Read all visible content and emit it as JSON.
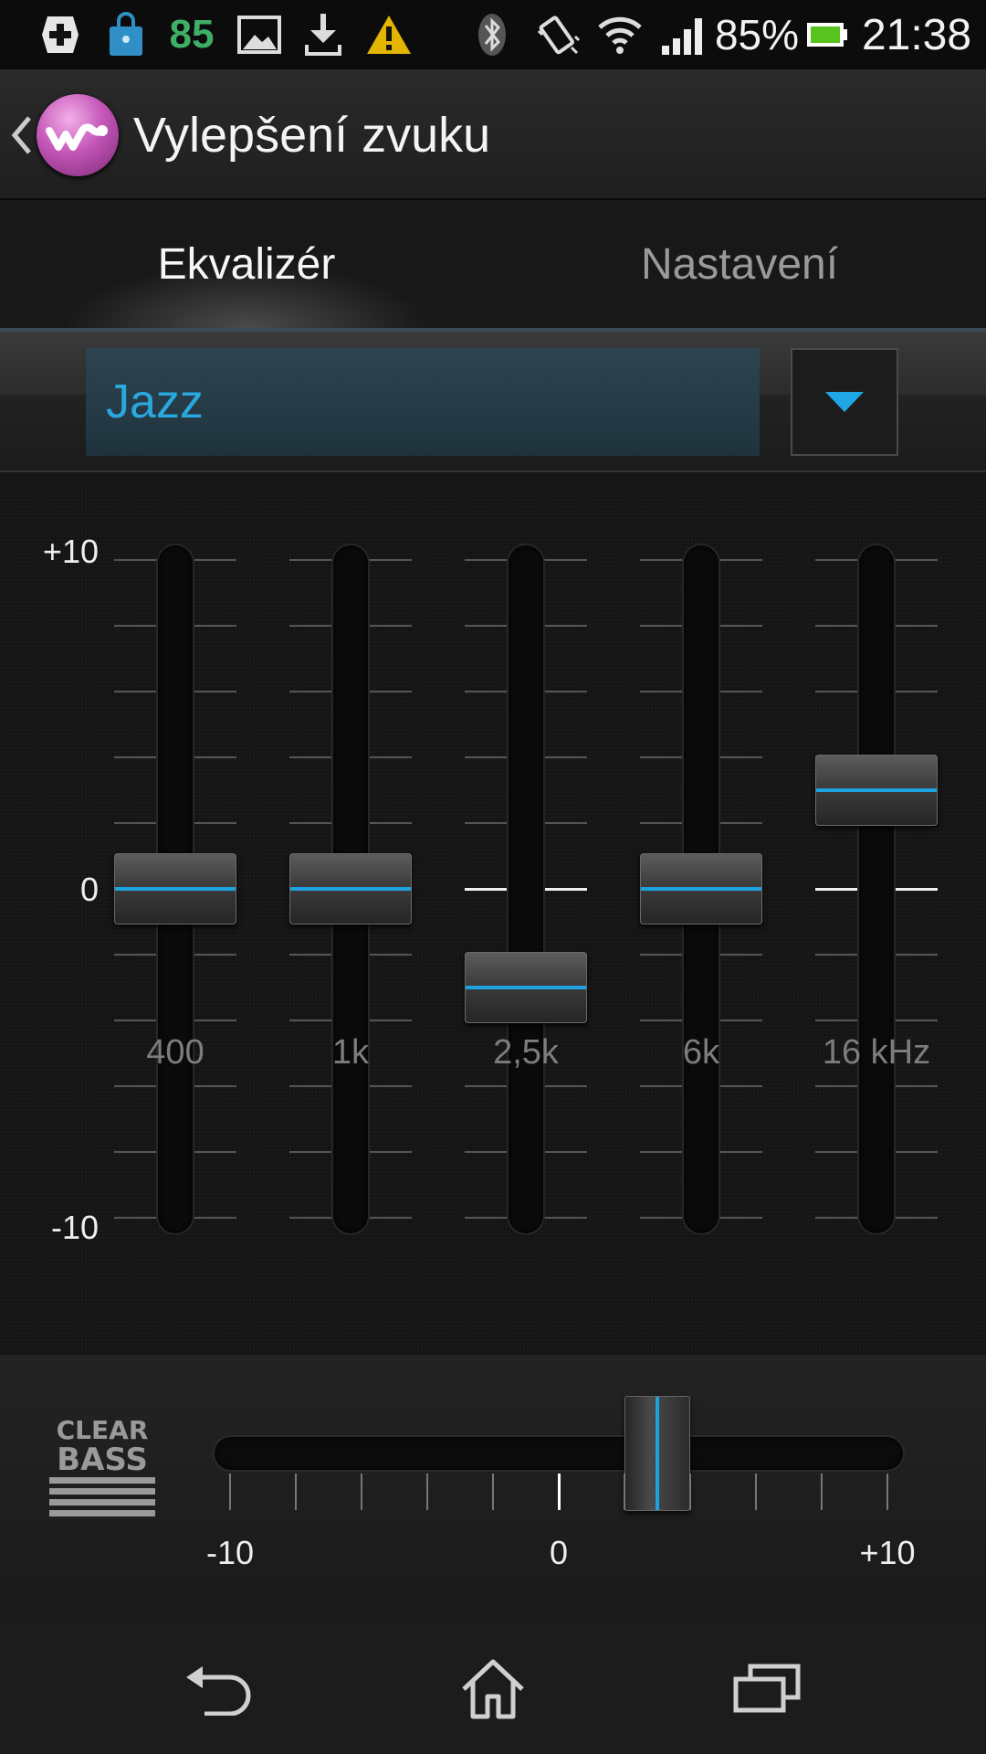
{
  "status_bar": {
    "notification_count": "85",
    "battery_percent": "85%",
    "time": "21:38",
    "icons": [
      "add-box-icon",
      "store-bag-icon",
      "gallery-icon",
      "download-icon",
      "warning-icon",
      "bluetooth-icon",
      "vibrate-icon",
      "wifi-icon",
      "signal-icon",
      "battery-icon"
    ]
  },
  "action_bar": {
    "title": "Vylepšení zvuku",
    "app_icon": "walkman-icon"
  },
  "tabs": [
    {
      "label": "Ekvalizér",
      "active": true
    },
    {
      "label": "Nastavení",
      "active": false
    }
  ],
  "preset": {
    "selected": "Jazz",
    "accent_color": "#29a8df"
  },
  "equalizer": {
    "scale_labels": {
      "max": "+10",
      "zero": "0",
      "min": "-10"
    },
    "bands": [
      {
        "label": "400",
        "value": 0
      },
      {
        "label": "1k",
        "value": 0
      },
      {
        "label": "2,5k",
        "value": -3
      },
      {
        "label": "6k",
        "value": 0
      },
      {
        "label": "16 kHz",
        "value": 3
      }
    ],
    "min": -10,
    "max": 10
  },
  "clear_bass": {
    "logo_text_top": "CLEAR",
    "logo_text_bottom": "BASS",
    "value": 3,
    "min": -10,
    "max": 10,
    "labels": {
      "min": "-10",
      "zero": "0",
      "max": "+10"
    }
  },
  "nav_bar": {
    "buttons": [
      "back-icon",
      "home-icon",
      "recent-apps-icon"
    ]
  }
}
